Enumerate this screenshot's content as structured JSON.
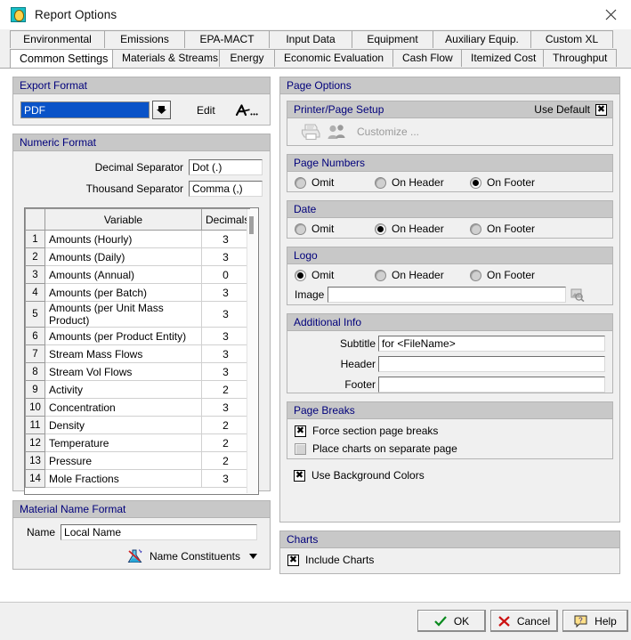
{
  "window": {
    "title": "Report Options",
    "app_icon": "report-options-icon",
    "close_icon": "close-icon"
  },
  "tabs": {
    "row1": [
      {
        "label": "Environmental",
        "active": false
      },
      {
        "label": "Emissions",
        "active": false
      },
      {
        "label": "EPA-MACT",
        "active": false
      },
      {
        "label": "Input Data",
        "active": false
      },
      {
        "label": "Equipment",
        "active": false
      },
      {
        "label": "Auxiliary Equip.",
        "active": false
      },
      {
        "label": "Custom XL",
        "active": false
      }
    ],
    "row2": [
      {
        "label": "Common Settings",
        "active": true
      },
      {
        "label": "Materials & Streams",
        "active": false
      },
      {
        "label": "Energy",
        "active": false
      },
      {
        "label": "Economic Evaluation",
        "active": false
      },
      {
        "label": "Cash Flow",
        "active": false
      },
      {
        "label": "Itemized Cost",
        "active": false
      },
      {
        "label": "Throughput",
        "active": false
      }
    ]
  },
  "export_format": {
    "title": "Export Format",
    "value": "PDF",
    "dropdown_icon": "chevron-down-icon",
    "edit_label": "Edit",
    "font_icon": "font-icon",
    "font_icon_label": "A..."
  },
  "numeric_format": {
    "title": "Numeric Format",
    "decimal_separator_label": "Decimal Separator",
    "decimal_separator_value": "Dot (.)",
    "thousand_separator_label": "Thousand Separator",
    "thousand_separator_value": "Comma (,)",
    "table": {
      "headers": [
        "",
        "Variable",
        "Decimals"
      ],
      "rows": [
        {
          "n": "1",
          "variable": "Amounts (Hourly)",
          "decimals": "3"
        },
        {
          "n": "2",
          "variable": "Amounts (Daily)",
          "decimals": "3"
        },
        {
          "n": "3",
          "variable": "Amounts (Annual)",
          "decimals": "0"
        },
        {
          "n": "4",
          "variable": "Amounts (per Batch)",
          "decimals": "3"
        },
        {
          "n": "5",
          "variable": "Amounts (per Unit Mass Product)",
          "decimals": "3"
        },
        {
          "n": "6",
          "variable": "Amounts (per Product Entity)",
          "decimals": "3"
        },
        {
          "n": "7",
          "variable": "Stream Mass Flows",
          "decimals": "3"
        },
        {
          "n": "8",
          "variable": "Stream Vol Flows",
          "decimals": "3"
        },
        {
          "n": "9",
          "variable": "Activity",
          "decimals": "2"
        },
        {
          "n": "10",
          "variable": "Concentration",
          "decimals": "3"
        },
        {
          "n": "11",
          "variable": "Density",
          "decimals": "2"
        },
        {
          "n": "12",
          "variable": "Temperature",
          "decimals": "2"
        },
        {
          "n": "13",
          "variable": "Pressure",
          "decimals": "2"
        },
        {
          "n": "14",
          "variable": "Mole Fractions",
          "decimals": "3"
        }
      ]
    }
  },
  "material_name_format": {
    "title": "Material Name Format",
    "name_label": "Name",
    "name_value": "Local Name",
    "constituents_label": "Name Constituents",
    "constituents_icon": "flask-icon",
    "constituents_caret": "caret-down-icon"
  },
  "page_options": {
    "title": "Page Options",
    "printer_page_setup": {
      "title": "Printer/Page Setup",
      "use_default_label": "Use Default",
      "use_default_checked": true,
      "printer_icon": "printer-icon",
      "users_icon": "users-icon",
      "customize_label": "Customize ..."
    },
    "page_numbers": {
      "title": "Page Numbers",
      "options": [
        "Omit",
        "On Header",
        "On Footer"
      ],
      "selected": "On Footer"
    },
    "date": {
      "title": "Date",
      "options": [
        "Omit",
        "On Header",
        "On Footer"
      ],
      "selected": "On Header"
    },
    "logo": {
      "title": "Logo",
      "options": [
        "Omit",
        "On Header",
        "On Footer"
      ],
      "selected": "Omit",
      "image_label": "Image",
      "image_value": "",
      "browse_icon": "browse-image-icon"
    },
    "additional_info": {
      "title": "Additional Info",
      "subtitle_label": "Subtitle",
      "subtitle_value": "for <FileName>",
      "header_label": "Header",
      "header_value": "",
      "footer_label": "Footer",
      "footer_value": ""
    },
    "page_breaks": {
      "title": "Page Breaks",
      "force_section_label": "Force section page breaks",
      "force_section_checked": true,
      "place_charts_label": "Place charts on separate page",
      "place_charts_checked": false
    },
    "use_background_colors_label": "Use Background Colors",
    "use_background_colors_checked": true,
    "charts": {
      "title": "Charts",
      "include_charts_label": "Include Charts",
      "include_charts_checked": true
    }
  },
  "buttons": {
    "ok": "OK",
    "cancel": "Cancel",
    "help": "Help",
    "ok_icon": "check-icon",
    "cancel_icon": "x-icon",
    "help_icon": "question-icon"
  },
  "colors": {
    "accent_select": "#0a53c8",
    "group_header_bg": "#c8c8c8",
    "group_header_text": "#00007b",
    "dialog_bg": "#f0f0f0"
  }
}
